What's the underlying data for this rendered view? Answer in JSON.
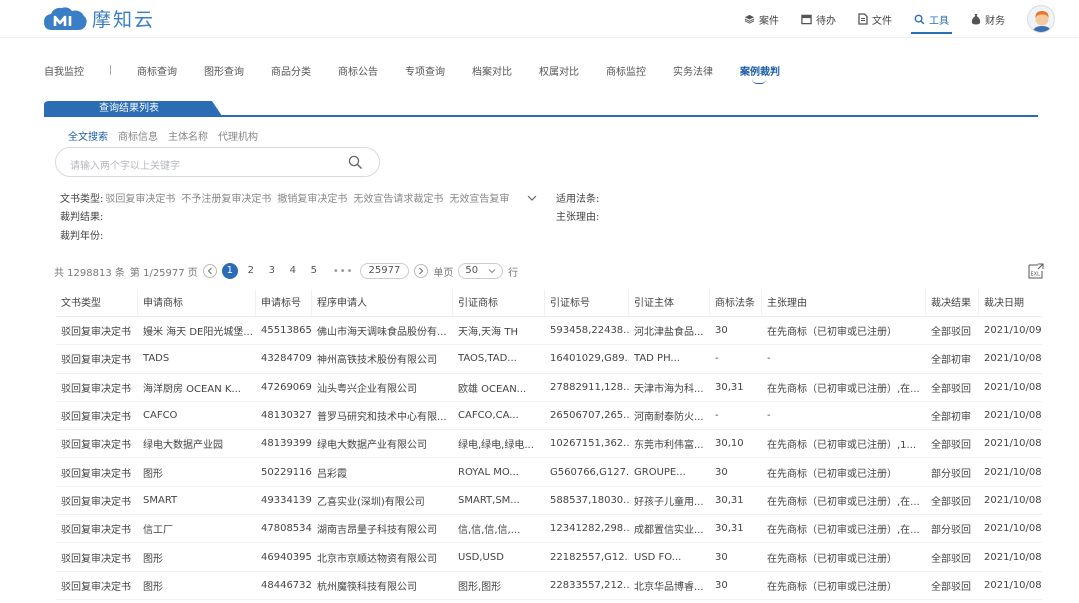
{
  "brand": {
    "name": "摩知云"
  },
  "topnav": [
    {
      "label": "案件",
      "icon": "cube-icon"
    },
    {
      "label": "待办",
      "icon": "inbox-icon"
    },
    {
      "label": "文件",
      "icon": "file-icon"
    },
    {
      "label": "工具",
      "icon": "search-icon",
      "active": true
    },
    {
      "label": "财务",
      "icon": "money-bag-icon"
    }
  ],
  "subnav": {
    "first": "自我监控",
    "items": [
      "商标查询",
      "图形查询",
      "商品分类",
      "商标公告",
      "专项查询",
      "档案对比",
      "权属对比",
      "商标监控",
      "实务法律",
      "案例裁判"
    ],
    "active": "案例裁判"
  },
  "result_tab": {
    "label": "查询结果列表"
  },
  "search_tabs": [
    "全文搜索",
    "商标信息",
    "主体名称",
    "代理机构"
  ],
  "search": {
    "placeholder": "请输入两个字以上关键字"
  },
  "filters": {
    "doc_type_label": "文书类型:",
    "doc_type_options": [
      "驳回复审决定书",
      "不予注册复审决定书",
      "撤销复审决定书",
      "无效宣告请求裁定书",
      "无效宣告复审"
    ],
    "law_label": "适用法条:",
    "result_label": "裁判结果:",
    "reason_label": "主张理由:",
    "year_label": "裁判年份:"
  },
  "pager": {
    "total": "共 1298813 条",
    "page_info": "第 1/25977 页",
    "pages": [
      "1",
      "2",
      "3",
      "4",
      "5"
    ],
    "ellipsis": "•••",
    "last_page": "25977",
    "per_page_label": "单页",
    "per_page": "50",
    "rows_label": "行"
  },
  "table": {
    "columns": [
      "文书类型",
      "申请商标",
      "申请标号",
      "程序申请人",
      "引证商标",
      "引证标号",
      "引证主体",
      "商标法条",
      "主张理由",
      "裁决结果",
      "裁决日期"
    ],
    "rows": [
      [
        "驳回复审决定书",
        "嫚米 海天 DE阳光城堡...",
        "45513865",
        "佛山市海天调味食品股份有...",
        "天海,天海 TH",
        "593458,22438...",
        "河北津盐食品...",
        "30",
        "在先商标（已初审或已注册）",
        "全部驳回",
        "2021/10/09"
      ],
      [
        "驳回复审决定书",
        "TADS",
        "43284709",
        "神州高铁技术股份有限公司",
        "TAOS,TAD...",
        "16401029,G89...",
        "TAD PH...",
        "-",
        "-",
        "全部初审",
        "2021/10/08"
      ],
      [
        "驳回复审决定书",
        "海洋厨房 OCEAN K...",
        "47269069",
        "汕头粤兴企业有限公司",
        "欧雄 OCEAN...",
        "27882911,128...",
        "天津市海为科...",
        "30,31",
        "在先商标（已初审或已注册）,在...",
        "全部驳回",
        "2021/10/08"
      ],
      [
        "驳回复审决定书",
        "CAFCO",
        "48130327",
        "普罗马研究和技术中心有限...",
        "CAFCO,CA...",
        "26506707,265...",
        "河南耐泰防火...",
        "-",
        "-",
        "全部初审",
        "2021/10/08"
      ],
      [
        "驳回复审决定书",
        "绿电大数据产业园",
        "48139399",
        "绿电大数据产业有限公司",
        "绿电,绿电,绿电...",
        "10267151,362...",
        "东莞市利伟富...",
        "30,10",
        "在先商标（已初审或已注册）,1...",
        "全部驳回",
        "2021/10/08"
      ],
      [
        "驳回复审决定书",
        "图形",
        "50229116",
        "吕彩霞",
        "ROYAL MO...",
        "G560766,G127...",
        "GROUPE...",
        "30",
        "在先商标（已初审或已注册）",
        "部分驳回",
        "2021/10/08"
      ],
      [
        "驳回复审决定书",
        "SMART",
        "49334139",
        "乙喜实业(深圳)有限公司",
        "SMART,SM...",
        "588537,18030...",
        "好孩子儿童用...",
        "30,31",
        "在先商标（已初审或已注册）,在...",
        "全部驳回",
        "2021/10/08"
      ],
      [
        "驳回复审决定书",
        "信工厂",
        "47808534",
        "湖南吉昂量子科技有限公司",
        "信,信,信,信,...",
        "12341282,298...",
        "成都置信实业...",
        "30,31",
        "在先商标（已初审或已注册）,在...",
        "部分驳回",
        "2021/10/08"
      ],
      [
        "驳回复审决定书",
        "图形",
        "46940395",
        "北京市京顺达物资有限公司",
        "USD,USD",
        "22182557,G12...",
        "USD FO...",
        "30",
        "在先商标（已初审或已注册）",
        "全部驳回",
        "2021/10/08"
      ],
      [
        "驳回复审决定书",
        "图形",
        "48446732",
        "杭州魔筷科技有限公司",
        "图形,图形",
        "22833557,212...",
        "北京华品博睿...",
        "30",
        "在先商标（已初审或已注册）",
        "全部驳回",
        "2021/10/08"
      ]
    ]
  },
  "colors": {
    "brand": "#3a7ec6",
    "accent": "#2b6cb7"
  }
}
